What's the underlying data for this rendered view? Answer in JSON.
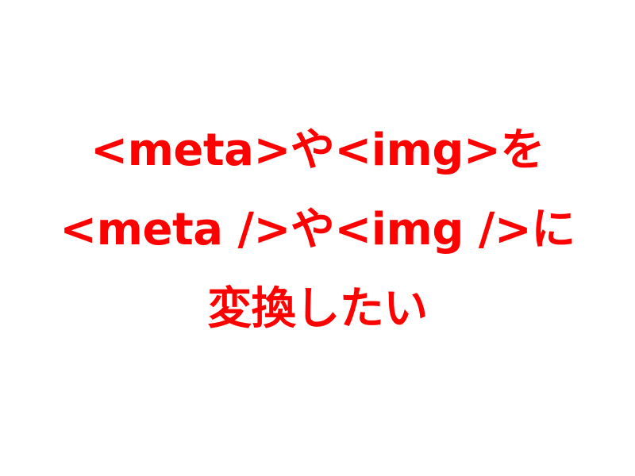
{
  "slide": {
    "text_color": "#ff0000",
    "background_color": "#ffffff",
    "lines": [
      "<meta>や<img>を",
      "<meta />や<img />に",
      "変換したい"
    ]
  }
}
